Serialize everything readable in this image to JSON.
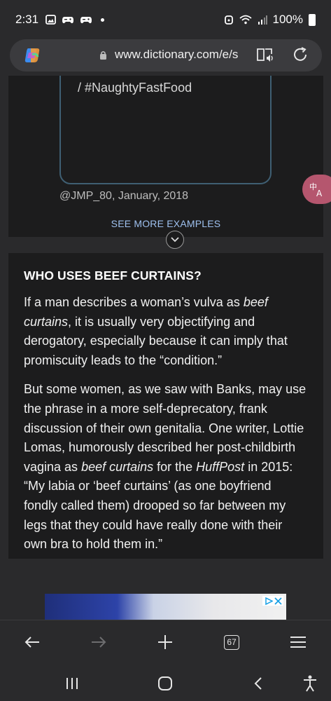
{
  "status_bar": {
    "time": "2:31",
    "battery": "100%",
    "icons_left": [
      "gallery-icon",
      "game-controller-icon",
      "game-controller-icon"
    ],
    "icons_right": [
      "alarm-icon",
      "wifi-icon",
      "signal-icon",
      "battery-icon"
    ]
  },
  "address_bar": {
    "url": "www.dictionary.com/e/s",
    "icons": [
      "copilot-icon",
      "lock-icon",
      "reader-mode-icon",
      "reload-icon"
    ]
  },
  "tweet": {
    "text": "/ #NaughtyFastFood",
    "meta": "@JMP_80, January, 2018"
  },
  "see_more": "SEE MORE EXAMPLES",
  "section": {
    "heading": "WHO USES BEEF CURTAINS?",
    "p1_a": "If a man describes a woman’s vulva as ",
    "p1_em": "beef curtains",
    "p1_b": ", it is usually very objectifying and derogatory, especially because it can imply that promiscuity leads to the “condition.”",
    "p2_a": "But some women, as we saw with Banks, may use the phrase in a more self-deprecatory, frank discussion of their own genitalia. One writer, Lottie Lomas, humorously described her post-childbirth vagina as ",
    "p2_em1": "beef curtains",
    "p2_b": " for the ",
    "p2_em2": "HuffPost",
    "p2_c": " in 2015: “My labia or ‘beef curtains’ (as one boyfriend fondly called them) drooped so far between my legs that they could have really done with their own bra to hold them in.”"
  },
  "toolbar": {
    "tab_count": "67",
    "icons": [
      "back-icon",
      "forward-icon",
      "new-tab-icon",
      "tabs-icon",
      "menu-icon"
    ]
  },
  "system_nav": {
    "icons": [
      "recent-apps-icon",
      "home-icon",
      "back-icon",
      "accessibility-icon"
    ]
  },
  "colors": {
    "background": "#2a2a2c",
    "card": "#1c1c1d",
    "link": "#9ec0ee",
    "translate_fab": "#b5566e"
  }
}
